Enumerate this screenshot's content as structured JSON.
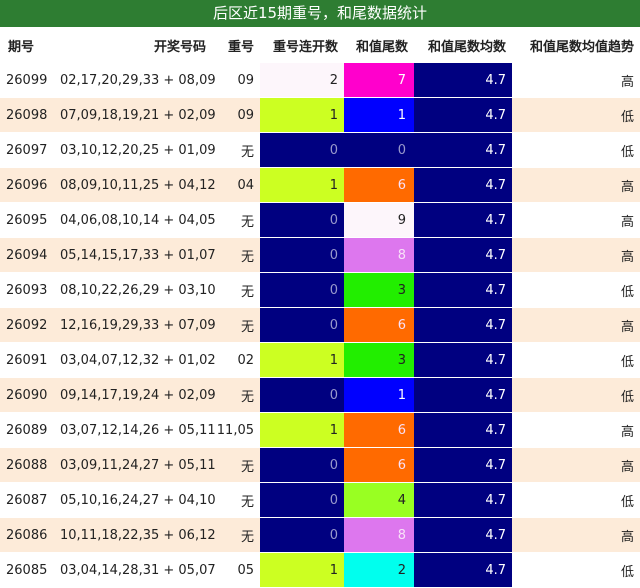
{
  "title": "后区近15期重号，和尾数据统计",
  "headers": {
    "period": "期号",
    "numbers": "开奖号码",
    "repeat": "重号",
    "consec": "重号连开数",
    "tail": "和值尾数",
    "avg": "和值尾数均数",
    "trend": "和值尾数均值趋势"
  },
  "colors": {
    "title_bg": "#2e7d32",
    "avg_bg": "#000080",
    "zero_consec_bg": "#000080",
    "one_consec_bg": "#ccff22",
    "two_consec_bg": "#fdf6fb",
    "row_alt_bg": "#fdebd9"
  },
  "rows": [
    {
      "period": "26099",
      "numbers": "02,17,20,29,33 + 08,09",
      "repeat": "09",
      "consec": "2",
      "tail": "7",
      "tail_color": "#ff00cc",
      "avg": "4.7",
      "trend": "高"
    },
    {
      "period": "26098",
      "numbers": "07,09,18,19,21 + 02,09",
      "repeat": "09",
      "consec": "1",
      "tail": "1",
      "tail_color": "#0000ff",
      "avg": "4.7",
      "trend": "低"
    },
    {
      "period": "26097",
      "numbers": "03,10,12,20,25 + 01,09",
      "repeat": "无",
      "consec": "0",
      "tail": "0",
      "tail_color": "#000080",
      "avg": "4.7",
      "trend": "低"
    },
    {
      "period": "26096",
      "numbers": "08,09,10,11,25 + 04,12",
      "repeat": "04",
      "consec": "1",
      "tail": "6",
      "tail_color": "#ff6a00",
      "avg": "4.7",
      "trend": "高"
    },
    {
      "period": "26095",
      "numbers": "04,06,08,10,14 + 04,05",
      "repeat": "无",
      "consec": "0",
      "tail": "9",
      "tail_color": "#fdf6fb",
      "avg": "4.7",
      "trend": "高"
    },
    {
      "period": "26094",
      "numbers": "05,14,15,17,33 + 01,07",
      "repeat": "无",
      "consec": "0",
      "tail": "8",
      "tail_color": "#dd77ee",
      "avg": "4.7",
      "trend": "高"
    },
    {
      "period": "26093",
      "numbers": "08,10,22,26,29 + 03,10",
      "repeat": "无",
      "consec": "0",
      "tail": "3",
      "tail_color": "#22ee00",
      "avg": "4.7",
      "trend": "低"
    },
    {
      "period": "26092",
      "numbers": "12,16,19,29,33 + 07,09",
      "repeat": "无",
      "consec": "0",
      "tail": "6",
      "tail_color": "#ff6a00",
      "avg": "4.7",
      "trend": "高"
    },
    {
      "period": "26091",
      "numbers": "03,04,07,12,32 + 01,02",
      "repeat": "02",
      "consec": "1",
      "tail": "3",
      "tail_color": "#22ee00",
      "avg": "4.7",
      "trend": "低"
    },
    {
      "period": "26090",
      "numbers": "09,14,17,19,24 + 02,09",
      "repeat": "无",
      "consec": "0",
      "tail": "1",
      "tail_color": "#0000ff",
      "avg": "4.7",
      "trend": "低"
    },
    {
      "period": "26089",
      "numbers": "03,07,12,14,26 + 05,11",
      "repeat": "11,05",
      "consec": "1",
      "tail": "6",
      "tail_color": "#ff6a00",
      "avg": "4.7",
      "trend": "高"
    },
    {
      "period": "26088",
      "numbers": "03,09,11,24,27 + 05,11",
      "repeat": "无",
      "consec": "0",
      "tail": "6",
      "tail_color": "#ff6a00",
      "avg": "4.7",
      "trend": "高"
    },
    {
      "period": "26087",
      "numbers": "05,10,16,24,27 + 04,10",
      "repeat": "无",
      "consec": "0",
      "tail": "4",
      "tail_color": "#99ff22",
      "avg": "4.7",
      "trend": "低"
    },
    {
      "period": "26086",
      "numbers": "10,11,18,22,35 + 06,12",
      "repeat": "无",
      "consec": "0",
      "tail": "8",
      "tail_color": "#dd77ee",
      "avg": "4.7",
      "trend": "高"
    },
    {
      "period": "26085",
      "numbers": "03,04,14,28,31 + 05,07",
      "repeat": "05",
      "consec": "1",
      "tail": "2",
      "tail_color": "#00ffee",
      "avg": "4.7",
      "trend": "低"
    }
  ]
}
